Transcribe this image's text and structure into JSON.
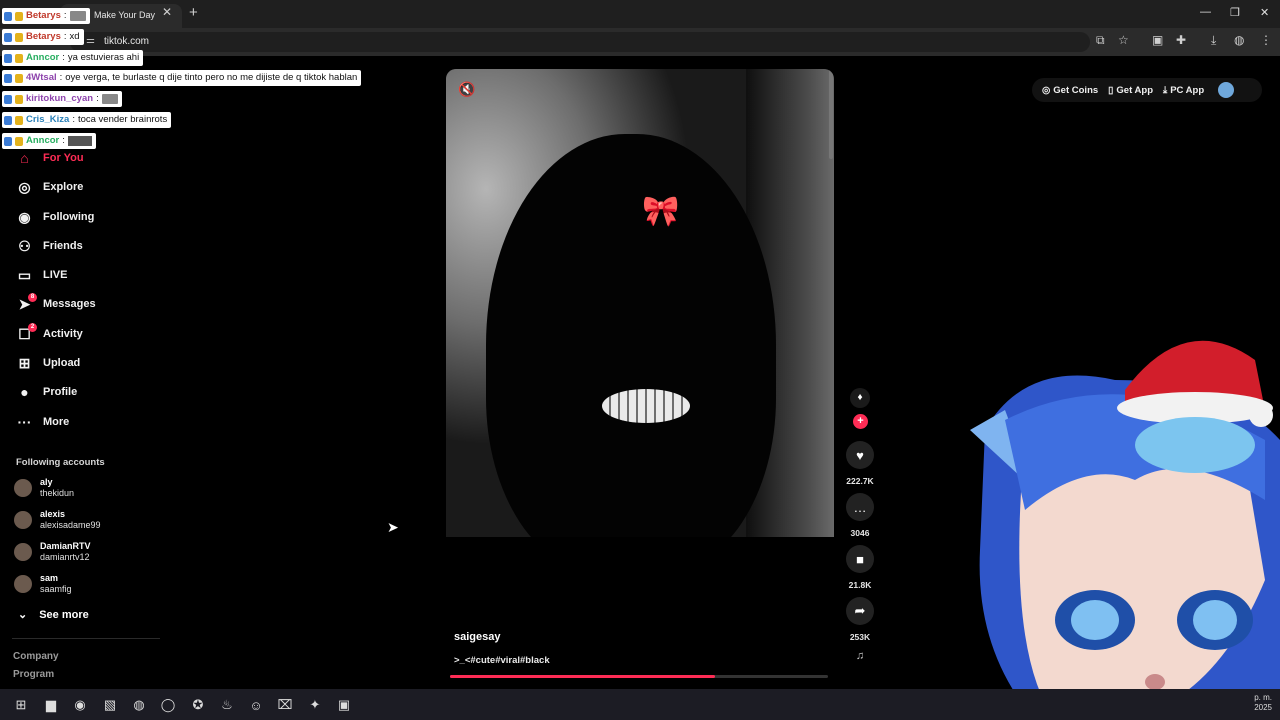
{
  "browser": {
    "tab_title": "Make Your Day",
    "url": "tiktok.com"
  },
  "chat": [
    {
      "user": "Betarys",
      "text": "",
      "user_color": "#c0392b"
    },
    {
      "user": "Betarys",
      "text": "xd",
      "user_color": "#c0392b"
    },
    {
      "user": "Anncor",
      "text": "ya estuvieras ahi",
      "user_color": "#27ae60"
    },
    {
      "user": "4Wtsal",
      "text": "oye verga, te burlaste q dije tinto pero no me dijiste de q tiktok hablan",
      "user_color": "#8e44ad"
    },
    {
      "user": "kiritokun_cyan",
      "text": "",
      "user_color": "#8e44ad"
    },
    {
      "user": "Cris_Kiza",
      "text": "toca vender brainrots",
      "user_color": "#2980b9"
    },
    {
      "user": "Anncor",
      "text": "",
      "user_color": "#27ae60"
    }
  ],
  "sidebar": {
    "nav": [
      {
        "label": "For You",
        "icon": "home-icon",
        "glyph": "⌂"
      },
      {
        "label": "Explore",
        "icon": "compass-icon",
        "glyph": "◎"
      },
      {
        "label": "Following",
        "icon": "following-icon",
        "glyph": "◉"
      },
      {
        "label": "Friends",
        "icon": "friends-icon",
        "glyph": "⚇"
      },
      {
        "label": "LIVE",
        "icon": "live-icon",
        "glyph": "▭"
      },
      {
        "label": "Messages",
        "icon": "messages-icon",
        "glyph": "➤",
        "badge": "8"
      },
      {
        "label": "Activity",
        "icon": "activity-icon",
        "glyph": "☐",
        "badge": "2"
      },
      {
        "label": "Upload",
        "icon": "upload-icon",
        "glyph": "⊞"
      },
      {
        "label": "Profile",
        "icon": "profile-icon",
        "glyph": "●"
      },
      {
        "label": "More",
        "icon": "more-icon",
        "glyph": "···"
      }
    ],
    "following_title": "Following accounts",
    "accounts": [
      {
        "name": "aly",
        "handle": "thekidun"
      },
      {
        "name": "alexis",
        "handle": "alexisadame99"
      },
      {
        "name": "DamianRTV",
        "handle": "damianrtv12"
      },
      {
        "name": "sam",
        "handle": "saamfig"
      }
    ],
    "see_more": "See more",
    "footer": [
      "Company",
      "Program"
    ]
  },
  "video": {
    "author": "saigesay",
    "caption": ">_<#cute#viral#black",
    "progress": 0.7,
    "likes": "222.7K",
    "comments": "3046",
    "saves": "21.8K",
    "shares": "253K"
  },
  "top_actions": {
    "get_coins": "Get Coins",
    "get_app": "Get App",
    "pc_app": "PC App"
  },
  "clock": {
    "time": "p. m.",
    "year": "2025"
  },
  "colors": {
    "accent": "#fe2c55"
  }
}
